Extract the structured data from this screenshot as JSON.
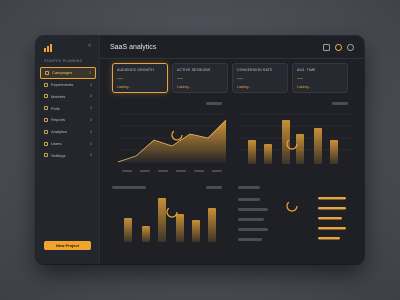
{
  "app": {
    "title": "SaaS analytics"
  },
  "sidebar": {
    "section_label": "STARTED PLANNING",
    "items": [
      {
        "label": "Campaigns",
        "count": "2",
        "active": true
      },
      {
        "label": "Experiments",
        "count": "4",
        "active": false
      },
      {
        "label": "Markets",
        "count": "8",
        "active": false
      },
      {
        "label": "Polls",
        "count": "9",
        "active": false
      },
      {
        "label": "Reports",
        "count": "5",
        "active": false
      },
      {
        "label": "Analytics",
        "count": "5",
        "active": false
      },
      {
        "label": "Users",
        "count": "3",
        "active": false
      },
      {
        "label": "Settings",
        "count": "9",
        "active": false
      }
    ],
    "new_project_label": "New Project"
  },
  "kpis": [
    {
      "label": "AUDIENCE GROWTH",
      "value": "---",
      "status": "Loading..."
    },
    {
      "label": "ACTIVE SESSIONS",
      "value": "---",
      "status": "Loading..."
    },
    {
      "label": "CONVERSION RATE",
      "value": "---",
      "status": "Loading..."
    },
    {
      "label": "AVG. TIME",
      "value": "---",
      "status": "Loading..."
    }
  ],
  "colors": {
    "accent": "#f0a32e",
    "background": "#1e2026",
    "panel": "#262930"
  },
  "icons": [
    "logo-icon",
    "collapse-icon",
    "export-icon",
    "notification-icon",
    "settings-icon"
  ]
}
